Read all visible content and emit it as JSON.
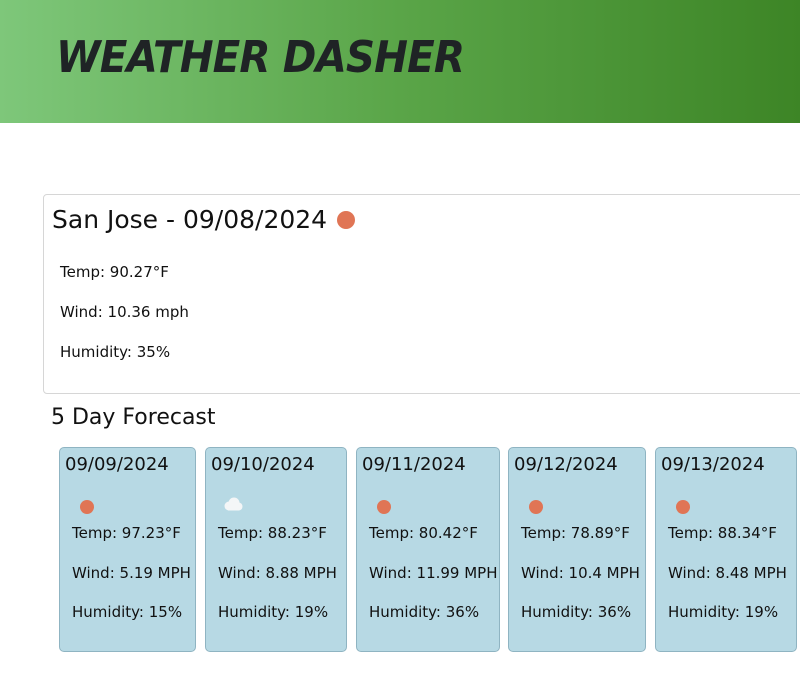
{
  "header": {
    "title": "WEATHER DASHER"
  },
  "current": {
    "title": "San Jose - 09/08/2024",
    "icon": "sun-icon",
    "temp": "Temp: 90.27°F",
    "wind": "Wind: 10.36 mph",
    "humidity": "Humidity: 35%"
  },
  "forecast": {
    "heading": "5 Day Forecast",
    "days": [
      {
        "date": "09/09/2024",
        "icon": "sun-icon",
        "temp": "Temp: 97.23°F",
        "wind": "Wind: 5.19 MPH",
        "humidity": "Humidity: 15%"
      },
      {
        "date": "09/10/2024",
        "icon": "cloud-icon",
        "temp": "Temp: 88.23°F",
        "wind": "Wind: 8.88 MPH",
        "humidity": "Humidity: 19%"
      },
      {
        "date": "09/11/2024",
        "icon": "sun-icon",
        "temp": "Temp: 80.42°F",
        "wind": "Wind: 11.99 MPH",
        "humidity": "Humidity: 36%"
      },
      {
        "date": "09/12/2024",
        "icon": "sun-icon",
        "temp": "Temp: 78.89°F",
        "wind": "Wind: 10.4 MPH",
        "humidity": "Humidity: 36%"
      },
      {
        "date": "09/13/2024",
        "icon": "sun-icon",
        "temp": "Temp: 88.34°F",
        "wind": "Wind: 8.48 MPH",
        "humidity": "Humidity: 19%"
      }
    ]
  },
  "colors": {
    "header_start": "#7ec77a",
    "header_end": "#3d8526",
    "card_bg": "#b7d9e4",
    "sun": "#e07555"
  }
}
